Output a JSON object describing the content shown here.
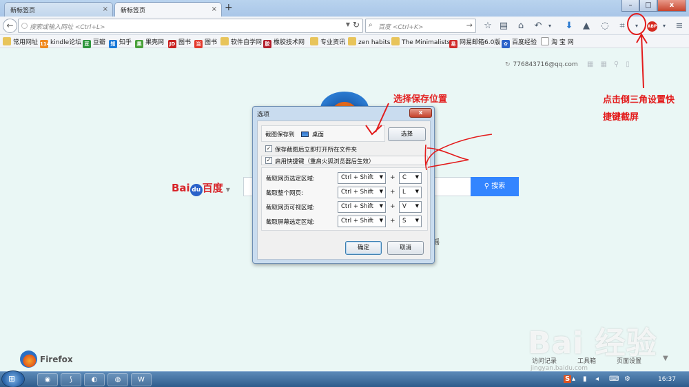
{
  "window": {
    "tabs": [
      {
        "title": "新标签页",
        "close": "×"
      },
      {
        "title": "新标签页",
        "close": "×"
      }
    ],
    "new_tab": "+",
    "controls": {
      "minimize": "–",
      "maximize": "□",
      "close": "x"
    }
  },
  "navbar": {
    "back": "←",
    "url_placeholder": "搜索或输入网址 <Ctrl+L>",
    "url_dropdown": "▼",
    "reload": "↻",
    "search_placeholder": "百度 <Ctrl+K>",
    "search_icon": "magnifier-icon",
    "search_go": "→",
    "icons": [
      {
        "name": "star-icon",
        "glyph": "☆"
      },
      {
        "name": "reading-list-icon",
        "glyph": "▤"
      },
      {
        "name": "home-icon",
        "glyph": "⌂"
      },
      {
        "name": "undo-icon",
        "glyph": "↶"
      },
      {
        "name": "undo-dropdown-icon",
        "glyph": "▾"
      },
      {
        "name": "download-icon",
        "glyph": "⬇"
      },
      {
        "name": "rocket-icon",
        "glyph": "▲"
      },
      {
        "name": "rss-icon",
        "glyph": "◌"
      },
      {
        "name": "screenshot-crop-icon",
        "glyph": "⌗"
      },
      {
        "name": "screenshot-dropdown-icon",
        "glyph": "▾"
      },
      {
        "name": "menu-icon",
        "glyph": "≡"
      }
    ],
    "abp": "ABP",
    "abp_dropdown": "▾"
  },
  "bookmarks": [
    {
      "label": "常用网址",
      "icon": "folder-icon",
      "color": "#e8c45a",
      "glyph": ""
    },
    {
      "label": "kindle论坛",
      "icon": "kindle-icon",
      "color": "#f08a1e",
      "glyph": "114"
    },
    {
      "label": "豆瓣",
      "icon": "douban-icon",
      "color": "#2e963d",
      "glyph": "豆"
    },
    {
      "label": "知乎",
      "icon": "zhihu-icon",
      "color": "#1a7ad8",
      "glyph": "知"
    },
    {
      "label": "果壳网",
      "icon": "guokr-icon",
      "color": "#49a13a",
      "glyph": "果"
    },
    {
      "label": "图书",
      "icon": "jd-icon",
      "color": "#c9201f",
      "glyph": "JD"
    },
    {
      "label": "图书",
      "icon": "dangdang-icon",
      "color": "#e33b2e",
      "glyph": "当"
    },
    {
      "label": "软件自学网",
      "icon": "folder-icon",
      "color": "#e8c45a",
      "glyph": ""
    },
    {
      "label": "橡胶技术网",
      "icon": "rubber-icon",
      "color": "#b21e2b",
      "glyph": "胶"
    },
    {
      "label": "专业资讯",
      "icon": "folder-icon",
      "color": "#e8c45a",
      "glyph": ""
    },
    {
      "label": "zen habits",
      "icon": "folder-icon",
      "color": "#e8c45a",
      "glyph": ""
    },
    {
      "label": "The Minimalists",
      "icon": "folder-icon",
      "color": "#e8c45a",
      "glyph": ""
    },
    {
      "label": "网易邮箱6.0版",
      "icon": "netease-icon",
      "color": "#d12b2b",
      "glyph": "易"
    },
    {
      "label": "百度经验",
      "icon": "paw-icon",
      "color": "#2a62c9",
      "glyph": "✿"
    },
    {
      "label": "淘 宝 网",
      "icon": "page-icon",
      "color": "#ffffff",
      "glyph": ""
    }
  ],
  "page": {
    "account": "776843716@qq.com",
    "baidu_logo": {
      "bai": "Bai",
      "du": "du",
      "text": "百度",
      "dropdown": "▼"
    },
    "search_button": "搜索",
    "stray": "摇"
  },
  "dialog": {
    "title": "选项",
    "close": "x",
    "save_to_label": "截图保存到",
    "save_location": "桌面",
    "choose_button": "选择",
    "open_folder_label": "保存截图后立即打开所在文件夹",
    "open_folder_checked": "✓",
    "enable_hotkeys_label": "启用快捷键（重启火狐浏览器后生效）",
    "enable_hotkeys_checked": "✓",
    "plus": "+",
    "arrow": "▼",
    "hotkeys": [
      {
        "label": "截取网页选定区域:",
        "modifier": "Ctrl + Shift",
        "key": "C"
      },
      {
        "label": "截取整个网页:",
        "modifier": "Ctrl + Shift",
        "key": "L"
      },
      {
        "label": "截取网页可视区域:",
        "modifier": "Ctrl + Shift",
        "key": "V"
      },
      {
        "label": "截取屏幕选定区域:",
        "modifier": "Ctrl + Shift",
        "key": "S"
      }
    ],
    "ok_button": "确定",
    "cancel_button": "取消"
  },
  "annotations": {
    "choose_location": "选择保存位置",
    "hint_line1": "点击倒三角设置快",
    "hint_line2": "捷键截屏",
    "color": "#e31b1b"
  },
  "footer": {
    "brand": "Firefox",
    "history": "访问记录",
    "tools": "工具箱",
    "page_settings": "页面设置",
    "arrow": "▼"
  },
  "watermark": {
    "main": "Bai 经验",
    "url": "jingyan.baidu.com"
  },
  "taskbar": {
    "start": "⊞",
    "tasks": [
      {
        "name": "taskbar-firefox",
        "glyph": "◉"
      },
      {
        "name": "taskbar-pdf",
        "glyph": "⟆"
      },
      {
        "name": "taskbar-app-blue",
        "glyph": "◐"
      },
      {
        "name": "taskbar-chrome",
        "glyph": "◍"
      },
      {
        "name": "taskbar-word",
        "glyph": "W"
      }
    ],
    "tray": [
      "S",
      "▴",
      "▮",
      "◂",
      "⌨",
      "⚙"
    ],
    "clock": "16:37"
  }
}
